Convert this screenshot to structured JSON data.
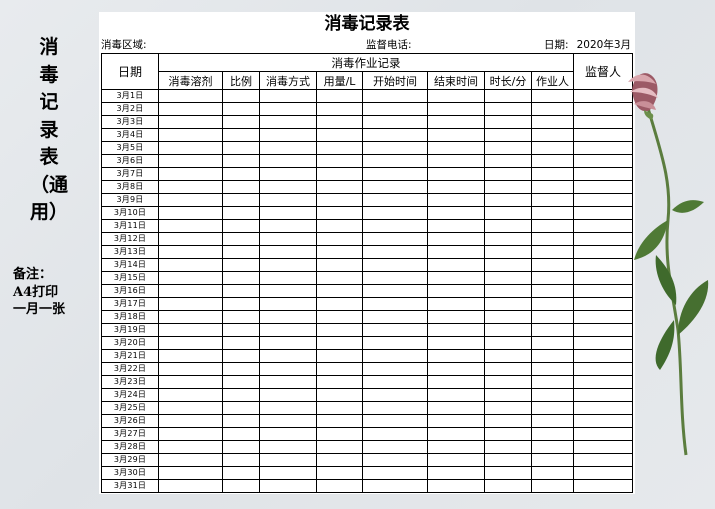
{
  "side_title": [
    "消",
    "毒",
    "记",
    "录",
    "表",
    "（通用）"
  ],
  "notes": {
    "label": "备注：",
    "lines": [
      "A4打印",
      "一月一张"
    ]
  },
  "sheet": {
    "title": "消毒记录表",
    "area_label": "消毒区域:",
    "phone_label": "监督电话:",
    "date_label": "日期:",
    "date_value": "2020年3月"
  },
  "table": {
    "date_header": "日期",
    "group_header": "消毒作业记录",
    "supervisor_header": "监督人",
    "columns": [
      "消毒溶剂",
      "比例",
      "消毒方式",
      "用量/L",
      "开始时间",
      "结束时间",
      "时长/分",
      "作业人"
    ],
    "rows": [
      "3月1日",
      "3月2日",
      "3月3日",
      "3月4日",
      "3月5日",
      "3月6日",
      "3月7日",
      "3月8日",
      "3月9日",
      "3月10日",
      "3月11日",
      "3月12日",
      "3月13日",
      "3月14日",
      "3月15日",
      "3月16日",
      "3月17日",
      "3月18日",
      "3月19日",
      "3月20日",
      "3月21日",
      "3月22日",
      "3月23日",
      "3月24日",
      "3月25日",
      "3月26日",
      "3月27日",
      "3月28日",
      "3月29日",
      "3月30日",
      "3月31日"
    ]
  },
  "colors": {
    "background": "#e3e6e9",
    "petal": "#d9a6ad",
    "petal_dark": "#9c5a66",
    "stem": "#5b7d3e",
    "leaf": "#3f6a2c"
  },
  "decor_icon": "flower-decoration"
}
